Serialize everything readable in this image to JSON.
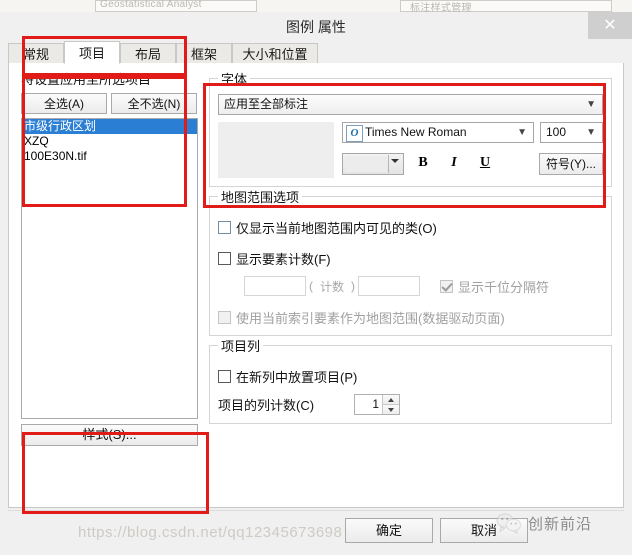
{
  "background": {
    "ghost_toolbar_text_left": "Geostatistical Analyst",
    "ghost_toolbar_text_right": "标注样式管理"
  },
  "dialog": {
    "title": "图例 属性",
    "close_icon": "close-icon"
  },
  "tabs": [
    {
      "label": "常规",
      "active": false
    },
    {
      "label": "项目",
      "active": true
    },
    {
      "label": "布局",
      "active": false
    },
    {
      "label": "框架",
      "active": false
    },
    {
      "label": "大小和位置",
      "active": false
    }
  ],
  "left_panel": {
    "apply_label": "将设置应用至所选项目",
    "select_all_button": "全选(A)",
    "select_none_button": "全不选(N)",
    "list_items": [
      {
        "label": "市级行政区划",
        "selected": true
      },
      {
        "label": "XZQ",
        "selected": false
      },
      {
        "label": "100E30N.tif",
        "selected": false
      }
    ],
    "style_button": "样式(S)..."
  },
  "font_group": {
    "legend": "字体",
    "apply_scope_value": "应用至全部标注",
    "font_family_value": "Times New Roman",
    "font_icon": "opentype-font-icon",
    "font_size_value": "100",
    "color_swatch_hex": "#ececec",
    "bold_label": "B",
    "italic_label": "I",
    "underline_label": "U",
    "symbol_button": "符号(Y)..."
  },
  "map_extent_group": {
    "legend": "地图范围选项",
    "only_visible_classes": {
      "label": "仅显示当前地图范围内可见的类(O)",
      "checked": false,
      "enabled": true
    },
    "show_feature_count": {
      "label": "显示要素计数(F)",
      "checked": false,
      "enabled": true
    },
    "prefix_value": "",
    "open_paren": "(",
    "count_label": "计数",
    "close_paren": ")",
    "suffix_value": "",
    "thousand_separator": {
      "label": "显示千位分隔符",
      "checked": true,
      "enabled": false
    },
    "use_index_feature": {
      "label": "使用当前索引要素作为地图范围(数据驱动页面)",
      "checked": false,
      "enabled": false
    }
  },
  "item_columns_group": {
    "legend": "项目列",
    "new_column": {
      "label": "在新列中放置项目(P)",
      "checked": false
    },
    "column_count_label": "项目的列计数(C)",
    "column_count_value": "1"
  },
  "footer": {
    "ok_button": "确定",
    "cancel_button": "取消"
  },
  "watermark": {
    "brand_text": "创新前沿",
    "url_text": "https://blog.csdn.net/qq12345673698",
    "logo_icon": "wechat-icon"
  }
}
